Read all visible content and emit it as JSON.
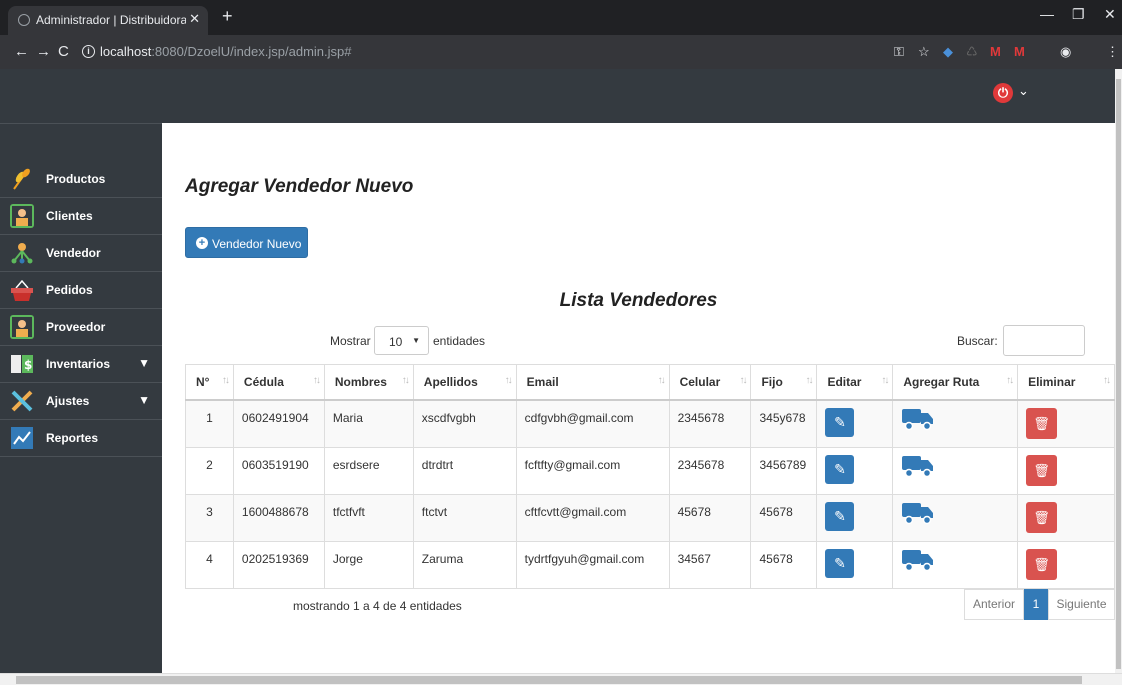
{
  "browser": {
    "tab_title": "Administrador | Distribuidora ZO",
    "url_host": "localhost",
    "url_path": ":8080/DzoelU/index.jsp/admin.jsp#"
  },
  "sidebar": {
    "items": [
      {
        "label": "Productos",
        "icon": "wheat-icon",
        "color": "#f0a020"
      },
      {
        "label": "Clientes",
        "icon": "client-icon",
        "color": "#5cb85c"
      },
      {
        "label": "Vendedor",
        "icon": "seller-network-icon",
        "color": "#f0ad4e"
      },
      {
        "label": "Pedidos",
        "icon": "basket-icon",
        "color": "#d9534f"
      },
      {
        "label": "Proveedor",
        "icon": "supplier-icon",
        "color": "#5cb85c"
      },
      {
        "label": "Inventarios",
        "icon": "inventory-icon",
        "color": "#5cb85c"
      },
      {
        "label": "Ajustes",
        "icon": "tools-icon",
        "color": "#f0ad4e"
      },
      {
        "label": "Reportes",
        "icon": "chart-icon",
        "color": "#337ab7"
      }
    ]
  },
  "main": {
    "title": "Agregar Vendedor Nuevo",
    "new_button": "Vendedor Nuevo",
    "list_title": "Lista Vendedores",
    "show_label": "Mostrar",
    "show_value": "10",
    "entities_label": "entidades",
    "search_label": "Buscar:",
    "columns": [
      "N°",
      "Cédula",
      "Nombres",
      "Apellidos",
      "Email",
      "Celular",
      "Fijo",
      "Editar",
      "Agregar Ruta",
      "Eliminar"
    ],
    "rows": [
      {
        "n": "1",
        "cedula": "0602491904",
        "nombres": "Maria",
        "apellidos": "xscdfvgbh",
        "email": "cdfgvbh@gmail.com",
        "celular": "2345678",
        "fijo": "345y678"
      },
      {
        "n": "2",
        "cedula": "0603519190",
        "nombres": "esrdsere",
        "apellidos": "dtrdtrt",
        "email": "fcftfty@gmail.com",
        "celular": "2345678",
        "fijo": "3456789"
      },
      {
        "n": "3",
        "cedula": "1600488678",
        "nombres": "tfctfvft",
        "apellidos": "ftctvt",
        "email": "cftfcvtt@gmail.com",
        "celular": "45678",
        "fijo": "45678"
      },
      {
        "n": "4",
        "cedula": "0202519369",
        "nombres": "Jorge",
        "apellidos": "Zaruma",
        "email": "tydrtfgyuh@gmail.com",
        "celular": "34567",
        "fijo": "45678"
      }
    ],
    "info": "mostrando 1 a 4 de 4 entidades",
    "pager": {
      "prev": "Anterior",
      "page": "1",
      "next": "Siguiente"
    }
  },
  "colors": {
    "primary": "#337ab7",
    "danger": "#d9534f",
    "dark": "#343a40"
  }
}
